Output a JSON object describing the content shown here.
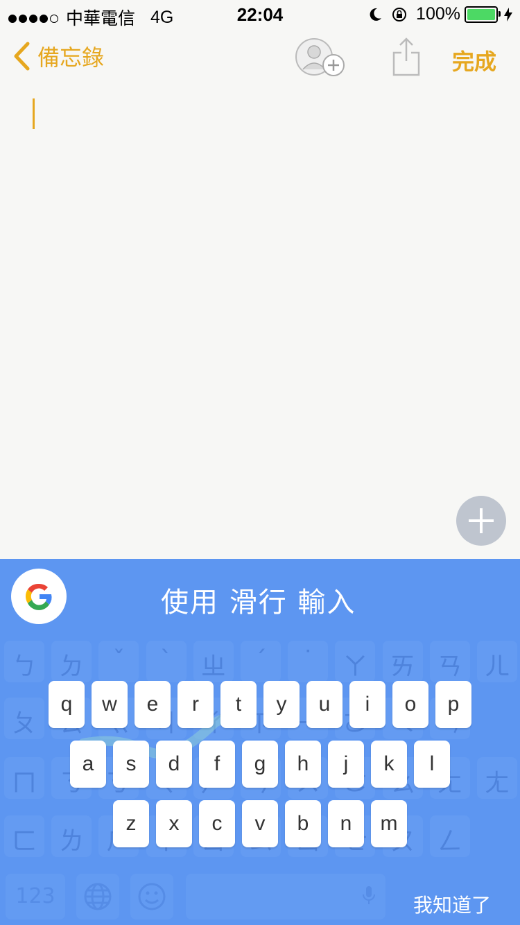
{
  "status_bar": {
    "signal_dots": "●●●●○",
    "carrier": "中華電信",
    "network": "4G",
    "time": "22:04",
    "battery": "100%"
  },
  "nav": {
    "back_label": "備忘錄",
    "done_label": "完成"
  },
  "keyboard": {
    "title": "使用 滑行 輸入",
    "row1": [
      "q",
      "w",
      "e",
      "r",
      "t",
      "y",
      "u",
      "i",
      "o",
      "p"
    ],
    "row2": [
      "a",
      "s",
      "d",
      "f",
      "g",
      "h",
      "j",
      "k",
      "l"
    ],
    "row3": [
      "z",
      "x",
      "c",
      "v",
      "b",
      "n",
      "m"
    ],
    "ghost_row1": [
      "ㄅ",
      "ㄉ",
      "ˇ",
      "ˋ",
      "ㄓ",
      "ˊ",
      "˙",
      "ㄚ",
      "ㄞ",
      "ㄢ",
      "ㄦ"
    ],
    "ghost_row2": [
      "ㄆ",
      "ㄊ",
      "ㄍ",
      "ㄐ",
      "ㄔ",
      "ㄗ",
      "ㄧ",
      "ㄛ",
      "ㄟ",
      "ㄣ"
    ],
    "ghost_row3": [
      "ㄇ",
      "ㄋ",
      "ㄎ",
      "ㄑ",
      "ㄕ",
      "ㄘ",
      "ㄨ",
      "ㄜ",
      "ㄠ",
      "ㄤ",
      "ㄤ"
    ],
    "ghost_row4": [
      "ㄈ",
      "ㄌ",
      "ㄏ",
      "ㄒ",
      "ㄖ",
      "ㄙ",
      "ㄩ",
      "ㄝ",
      "ㄡ",
      "ㄥ"
    ],
    "key_123": "123",
    "dismiss_label": "我知道了"
  },
  "colors": {
    "accent": "#e6a71f",
    "keyboard_bg": "#5d96f1"
  }
}
